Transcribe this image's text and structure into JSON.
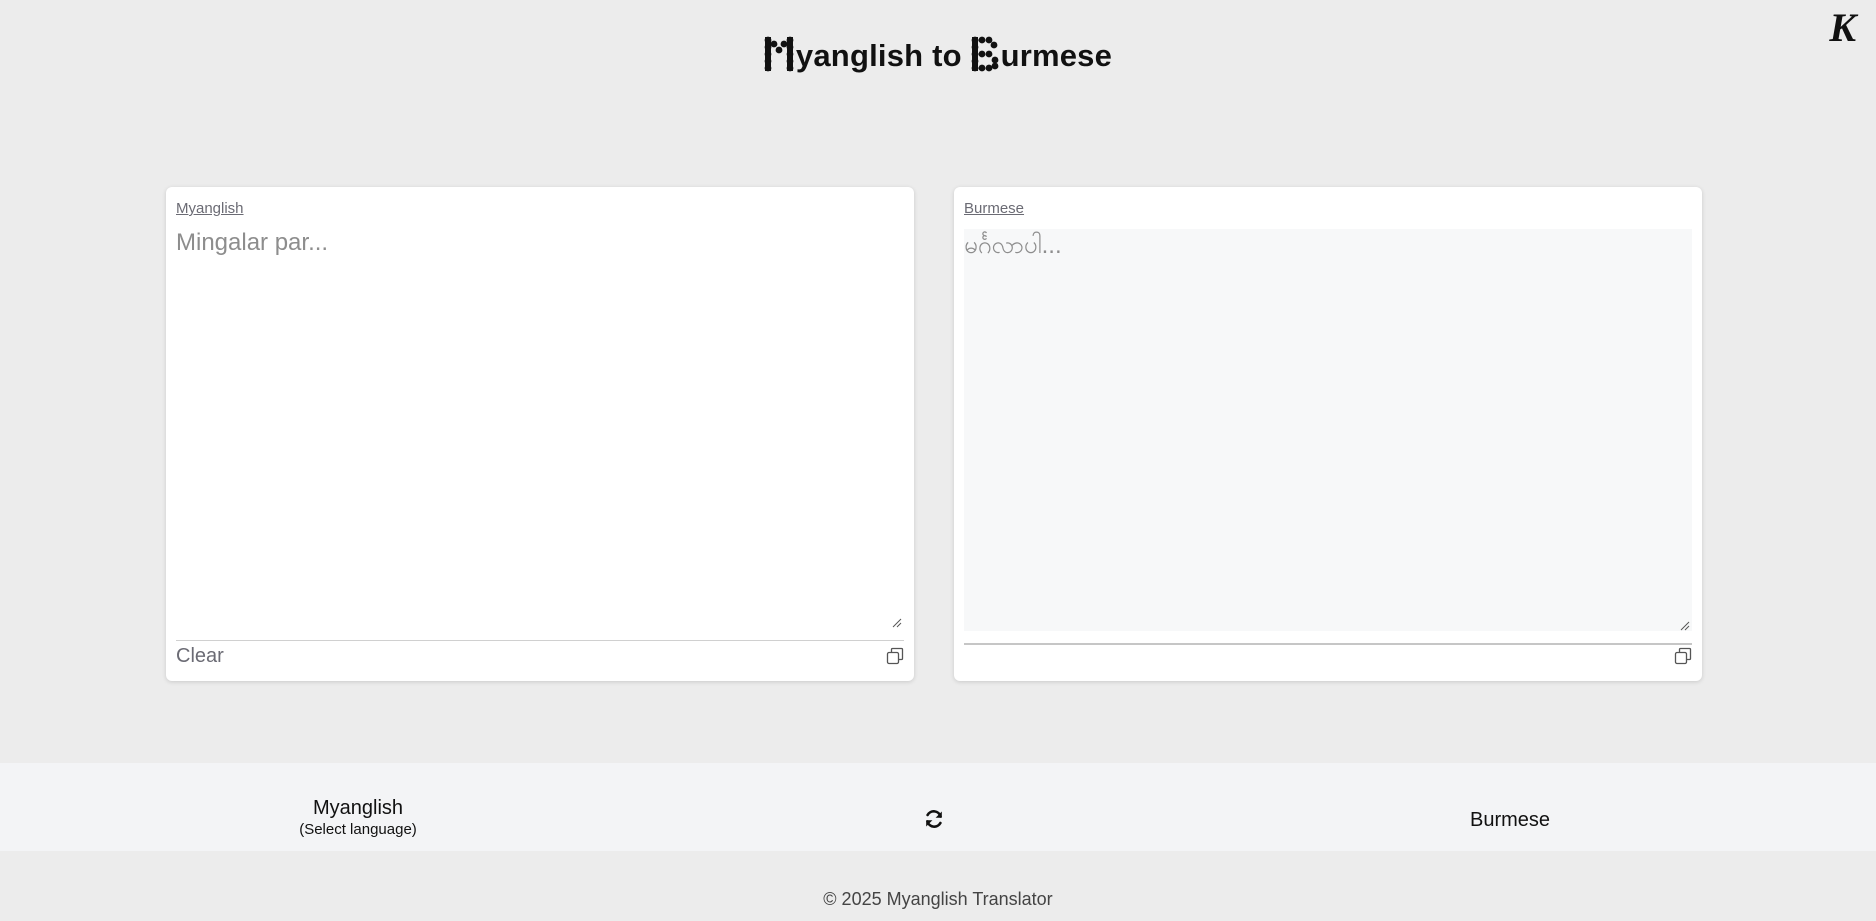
{
  "header": {
    "title_rest_1": "yanglish to ",
    "title_rest_2": "urmese",
    "title_initial_1": "M",
    "title_initial_2": "B",
    "logo_letter": "K"
  },
  "source_panel": {
    "label": "Myanglish",
    "placeholder": "Mingalar par...",
    "value": "",
    "clear_label": "Clear",
    "copy_icon": "copy-icon"
  },
  "target_panel": {
    "label": "Burmese",
    "placeholder": "မင်္ဂလာပါ...",
    "value": "",
    "copy_icon": "copy-icon"
  },
  "language_bar": {
    "source_language": "Myanglish",
    "source_hint": "(Select language)",
    "swap_icon": "refresh-swap-icon",
    "target_language": "Burmese"
  },
  "footer": {
    "copyright": "© 2025 Myanglish Translator"
  }
}
